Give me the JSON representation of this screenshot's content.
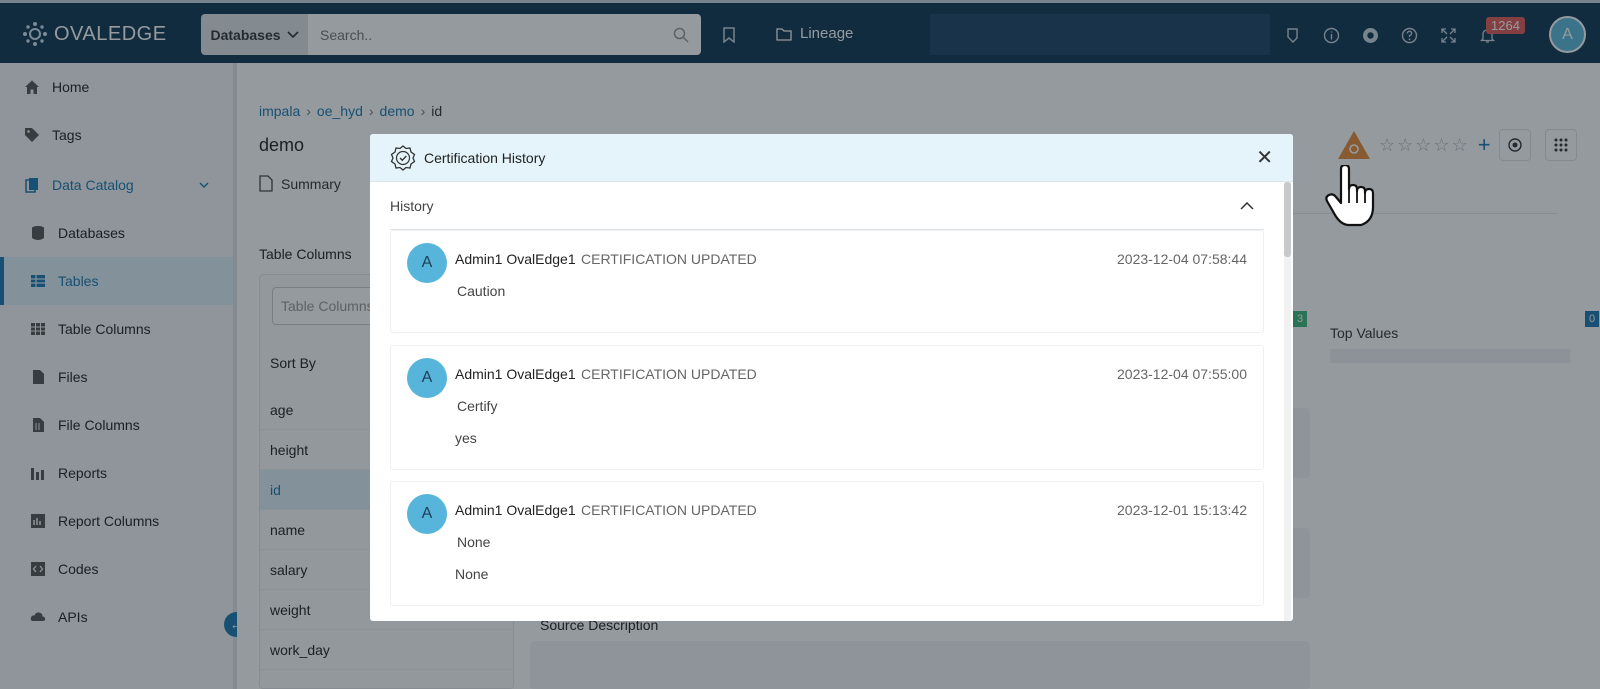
{
  "topbar": {
    "logo_text": "OVALEDGE",
    "search_type": "Databases",
    "search_placeholder": "Search..",
    "lineage_label": "Lineage",
    "notification_count": "1264",
    "avatar_initial": "A"
  },
  "sidebar": {
    "items": [
      {
        "label": "Home",
        "icon": "home-icon"
      },
      {
        "label": "Tags",
        "icon": "tag-icon"
      },
      {
        "label": "Data Catalog",
        "icon": "catalog-icon"
      },
      {
        "label": "Databases",
        "icon": "database-icon"
      },
      {
        "label": "Tables",
        "icon": "table-icon"
      },
      {
        "label": "Table Columns",
        "icon": "table-columns-icon"
      },
      {
        "label": "Files",
        "icon": "file-icon"
      },
      {
        "label": "File Columns",
        "icon": "file-columns-icon"
      },
      {
        "label": "Reports",
        "icon": "reports-icon"
      },
      {
        "label": "Report Columns",
        "icon": "report-columns-icon"
      },
      {
        "label": "Codes",
        "icon": "code-icon"
      },
      {
        "label": "APIs",
        "icon": "api-icon"
      }
    ]
  },
  "main": {
    "breadcrumb": [
      "impala",
      "oe_hyd",
      "demo",
      "id"
    ],
    "title": "demo",
    "tab_summary": "Summary",
    "table_columns_label": "Table Columns",
    "table_columns_search_placeholder": "Table Columns",
    "sort_by": "Sort By",
    "columns": [
      "age",
      "height",
      "id",
      "name",
      "salary",
      "weight",
      "work_day"
    ],
    "top_values": "Top Values",
    "badge_green": "3",
    "badge_blue": "0",
    "source_description": "Source Description"
  },
  "modal": {
    "title": "Certification History",
    "section": "History",
    "entries": [
      {
        "initial": "A",
        "user": "Admin1 OvalEdge1",
        "action": "CERTIFICATION UPDATED",
        "time": "2023-12-04 07:58:44",
        "line1": "Caution",
        "line2": ""
      },
      {
        "initial": "A",
        "user": "Admin1 OvalEdge1",
        "action": "CERTIFICATION UPDATED",
        "time": "2023-12-04 07:55:00",
        "line1": "Certify",
        "line2": "yes"
      },
      {
        "initial": "A",
        "user": "Admin1 OvalEdge1",
        "action": "CERTIFICATION UPDATED",
        "time": "2023-12-01 15:13:42",
        "line1": "None",
        "line2": "None"
      }
    ]
  },
  "colors": {
    "topbar": "#0f3653",
    "accent": "#1a78b0",
    "modal_header": "#e4f4fa",
    "avatar": "#57b5dc",
    "warning": "#e88a3a"
  }
}
